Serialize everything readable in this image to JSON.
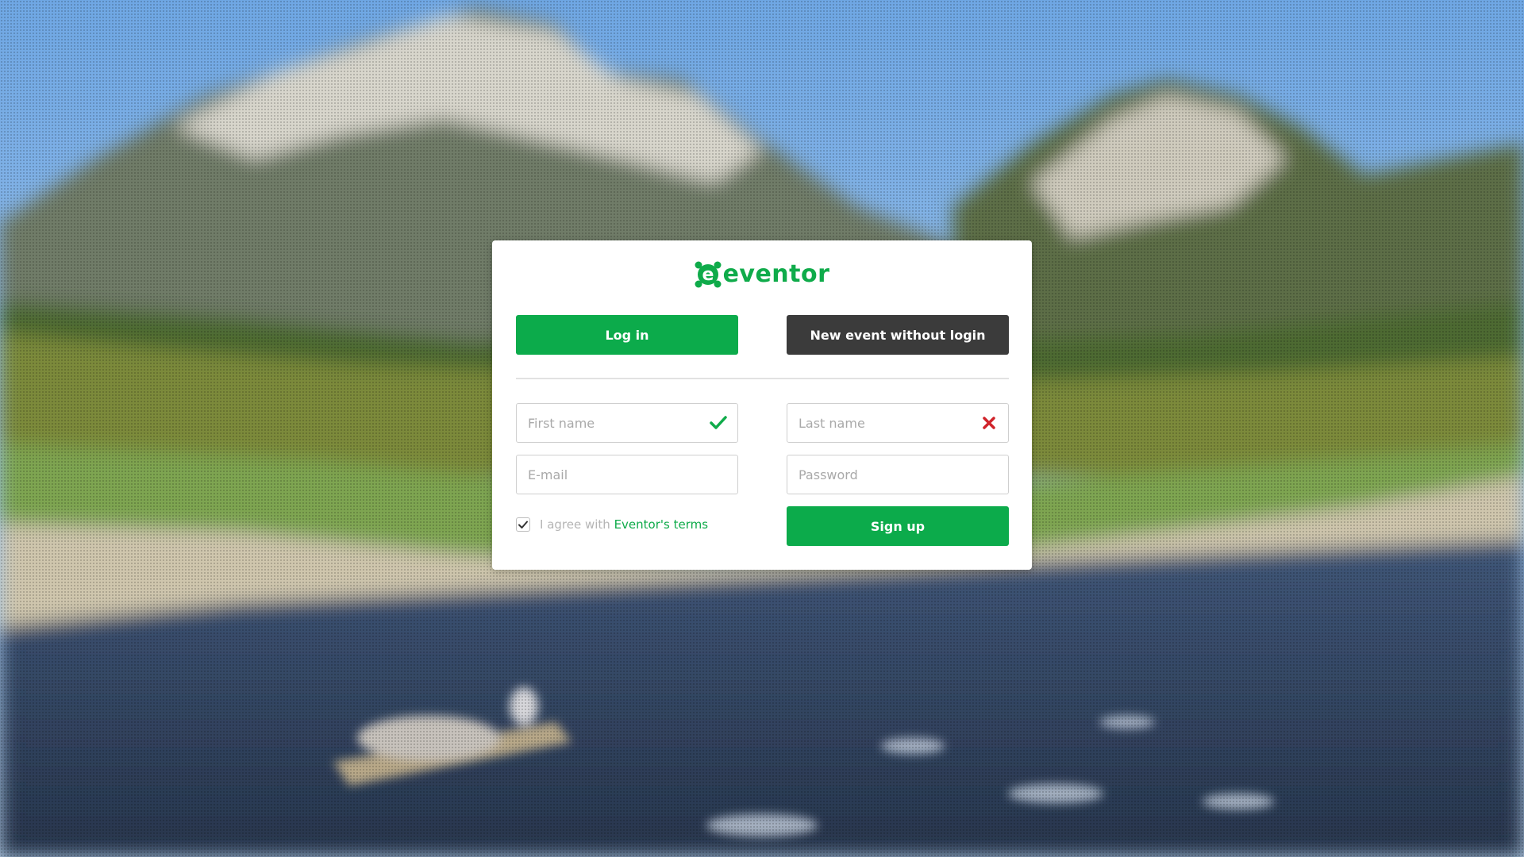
{
  "logo": {
    "text": "eventor",
    "brand_color": "#0fab4a"
  },
  "actions": {
    "login_label": "Log in",
    "no_login_label": "New event without login",
    "signup_label": "Sign up"
  },
  "form": {
    "first_name": {
      "placeholder": "First name",
      "value": "",
      "status": "valid",
      "status_icon": "check-icon"
    },
    "last_name": {
      "placeholder": "Last name",
      "value": "",
      "status": "invalid",
      "status_icon": "cross-icon"
    },
    "email": {
      "placeholder": "E-mail",
      "value": ""
    },
    "password": {
      "placeholder": "Password",
      "value": ""
    }
  },
  "terms": {
    "checked": true,
    "prefix": "I agree with",
    "link_text": "Eventor's terms"
  },
  "colors": {
    "primary": "#0cab4b",
    "dark": "#3b3b3b",
    "error": "#d0232a"
  }
}
